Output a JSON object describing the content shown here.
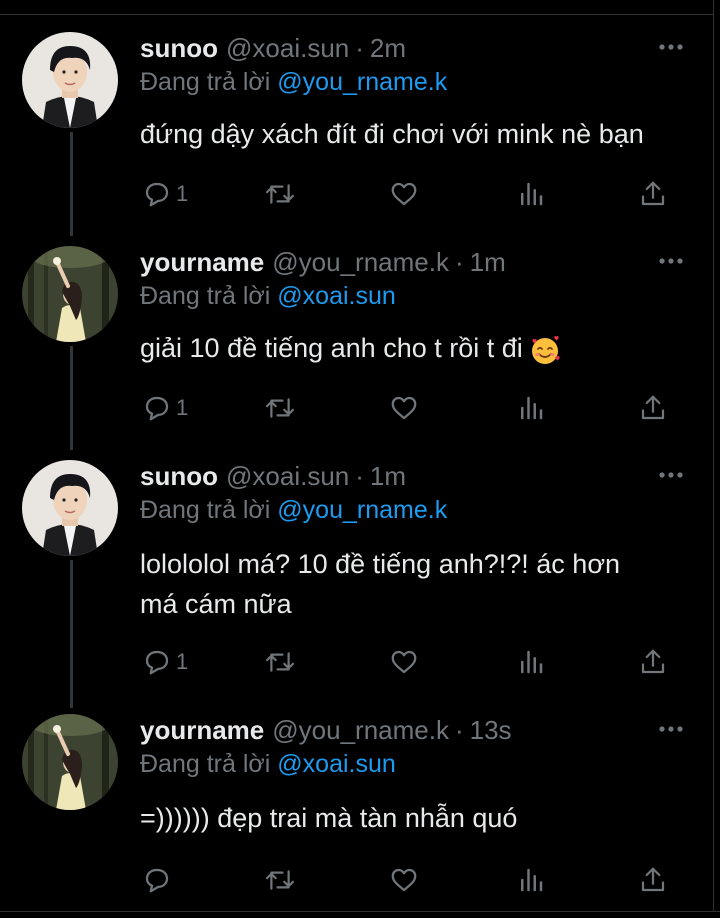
{
  "tweets": [
    {
      "name": "sunoo",
      "handle": "@xoai.sun",
      "time": "2m",
      "reply_prefix": "Đang trả lời",
      "reply_to": "@you_rname.k",
      "text_lines": [
        "đứng dậy xách đít đi chơi với mink nè bạn"
      ],
      "reply_count": "1",
      "avatar": "boy-avatar"
    },
    {
      "name": "yourname",
      "handle": "@you_rname.k",
      "time": "1m",
      "reply_prefix": "Đang trả lời",
      "reply_to": "@xoai.sun",
      "text_lines": [
        "giải 10 đề tiếng anh cho t rồi t đi"
      ],
      "emoji": "smiling-face-with-hearts-emoji",
      "reply_count": "1",
      "avatar": "girl-avatar"
    },
    {
      "name": "sunoo",
      "handle": "@xoai.sun",
      "time": "1m",
      "reply_prefix": "Đang trả lời",
      "reply_to": "@you_rname.k",
      "text_lines": [
        "lolololol má? 10 đề tiếng anh?!?! ác hơn",
        "má cám nữa"
      ],
      "reply_count": "1",
      "avatar": "boy-avatar"
    },
    {
      "name": "yourname",
      "handle": "@you_rname.k",
      "time": "13s",
      "reply_prefix": "Đang trả lời",
      "reply_to": "@xoai.sun",
      "text_lines": [
        "=)))))) đẹp trai mà tàn nhẫn quó"
      ],
      "reply_count": "",
      "avatar": "girl-avatar"
    }
  ],
  "icons": {
    "reply": "reply-icon",
    "retweet": "retweet-icon",
    "like": "heart-icon",
    "views": "views-icon",
    "share": "share-icon",
    "more": "more-icon"
  },
  "colors": {
    "background": "#000000",
    "text": "#e7e9ea",
    "muted": "#71767b",
    "link": "#1d9bf0",
    "thread_line": "#333639"
  }
}
